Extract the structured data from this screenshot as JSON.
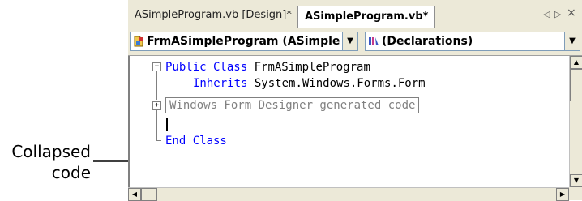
{
  "callout": {
    "line1": "Collapsed",
    "line2": "code"
  },
  "tabs": [
    {
      "label": "ASimpleProgram.vb [Design]*"
    },
    {
      "label": "ASimpleProgram.vb*"
    }
  ],
  "tab_controls": {
    "left": "◁",
    "right": "▷",
    "close": "×"
  },
  "nav": {
    "class_combo": "FrmASimpleProgram (ASimple",
    "member_combo": "(Declarations)"
  },
  "code": {
    "line1_kw": "Public Class",
    "line1_rest": " FrmASimpleProgram",
    "line2_kw": "Inherits",
    "line2_rest": " System.Windows.Forms.Form",
    "collapsed": "Windows Form Designer generated code",
    "line_end_kw": "End Class"
  },
  "outline": {
    "minus": "−",
    "plus": "+"
  }
}
